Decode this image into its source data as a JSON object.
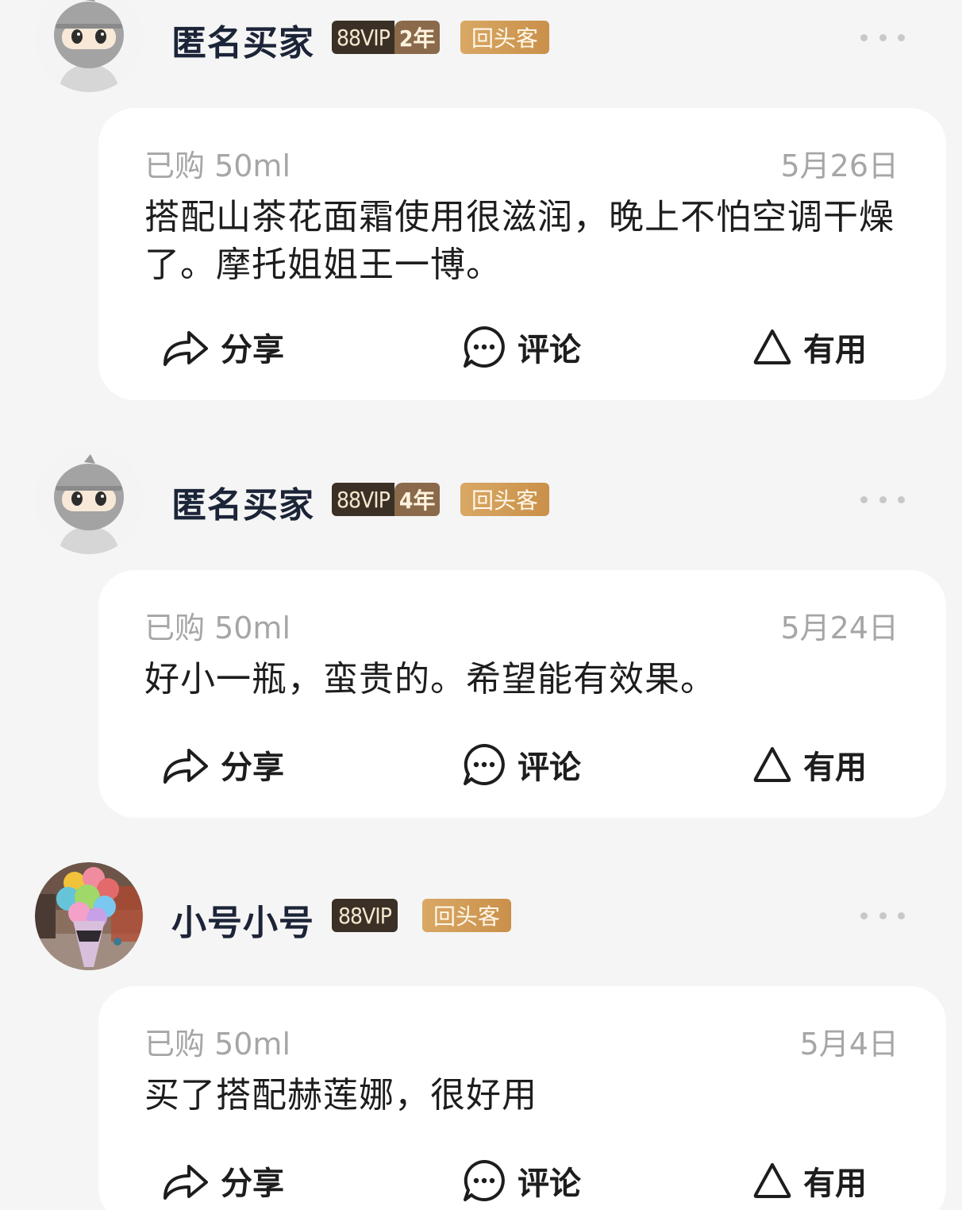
{
  "reviews": [
    {
      "username": "匿名买家",
      "vip": "88VIP",
      "vip_years": "2年",
      "repeat_badge": "回头客",
      "avatar_icon": "anonymous-ninja-avatar",
      "purchased": "已购 50ml",
      "date": "5月26日",
      "content": "搭配山茶花面霜使用很滋润，晚上不怕空调干燥了。摩托姐姐王一博。",
      "actions": {
        "share": "分享",
        "comment": "评论",
        "useful": "有用"
      }
    },
    {
      "username": "匿名买家",
      "vip": "88VIP",
      "vip_years": "4年",
      "repeat_badge": "回头客",
      "avatar_icon": "anonymous-ninja-avatar",
      "purchased": "已购 50ml",
      "date": "5月24日",
      "content": "好小一瓶，蛮贵的。希望能有效果。",
      "actions": {
        "share": "分享",
        "comment": "评论",
        "useful": "有用"
      }
    },
    {
      "username": "小号小号",
      "vip": "88VIP",
      "repeat_badge": "回头客",
      "avatar_icon": "ice-cream-photo-avatar",
      "purchased": "已购 50ml",
      "date": "5月4日",
      "content": "买了搭配赫莲娜，很好用",
      "actions": {
        "share": "分享",
        "comment": "评论",
        "useful": "有用"
      }
    }
  ],
  "colors": {
    "page_bg": "#f5f5f5",
    "card_bg": "#ffffff",
    "vip_dark": "#3a3026",
    "vip_year": "#8a6a4a",
    "repeat_gold": "#d9a865",
    "muted_text": "#a6a6a6"
  },
  "icons": [
    "share-icon",
    "comment-icon",
    "useful-icon",
    "more-icon"
  ]
}
